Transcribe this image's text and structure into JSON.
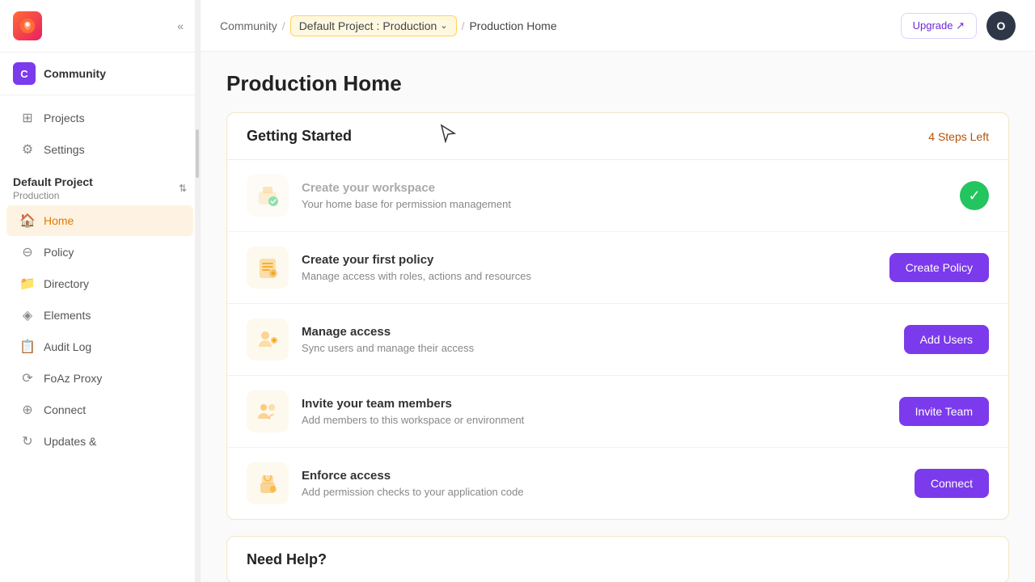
{
  "sidebar": {
    "logo_letter": "🦊",
    "workspace": {
      "letter": "C",
      "label": "Community"
    },
    "collapse_icon": "«",
    "nav_items": [
      {
        "id": "projects",
        "icon": "⊞",
        "label": "Projects"
      },
      {
        "id": "settings",
        "icon": "⚙",
        "label": "Settings"
      }
    ],
    "project": {
      "name": "Default Project",
      "env": "Production"
    },
    "project_nav": [
      {
        "id": "home",
        "icon": "🏠",
        "label": "Home",
        "active": true
      },
      {
        "id": "policy",
        "icon": "⊖",
        "label": "Policy"
      },
      {
        "id": "directory",
        "icon": "📁",
        "label": "Directory"
      },
      {
        "id": "elements",
        "icon": "◈",
        "label": "Elements"
      },
      {
        "id": "audit-log",
        "icon": "📋",
        "label": "Audit Log"
      },
      {
        "id": "foaz-proxy",
        "icon": "⟳",
        "label": "FoAz Proxy"
      },
      {
        "id": "connect",
        "icon": "⊕",
        "label": "Connect"
      },
      {
        "id": "updates",
        "icon": "↻",
        "label": "Updates &"
      }
    ]
  },
  "breadcrumb": {
    "community": "Community",
    "separator1": "/",
    "project": "Default Project",
    "colon": ":",
    "env": "Production",
    "separator2": "/",
    "current": "Production Home"
  },
  "header": {
    "upgrade_label": "Upgrade ↗",
    "avatar_letter": "O"
  },
  "page": {
    "title": "Production Home"
  },
  "getting_started": {
    "title": "Getting Started",
    "steps_left": "4 Steps Left",
    "steps": [
      {
        "id": "workspace",
        "icon": "🏢",
        "title": "Create your workspace",
        "desc": "Your home base for permission management",
        "completed": true,
        "action_label": null
      },
      {
        "id": "policy",
        "icon": "📜",
        "title": "Create your first policy",
        "desc": "Manage access with roles, actions and resources",
        "completed": false,
        "action_label": "Create Policy"
      },
      {
        "id": "access",
        "icon": "👤",
        "title": "Manage access",
        "desc": "Sync users and manage their access",
        "completed": false,
        "action_label": "Add Users"
      },
      {
        "id": "team",
        "icon": "👥",
        "title": "Invite your team members",
        "desc": "Add members to this workspace or environment",
        "completed": false,
        "action_label": "Invite Team"
      },
      {
        "id": "enforce",
        "icon": "🔒",
        "title": "Enforce access",
        "desc": "Add permission checks to your application code",
        "completed": false,
        "action_label": "Connect"
      }
    ]
  },
  "need_help": {
    "title": "Need Help?"
  }
}
